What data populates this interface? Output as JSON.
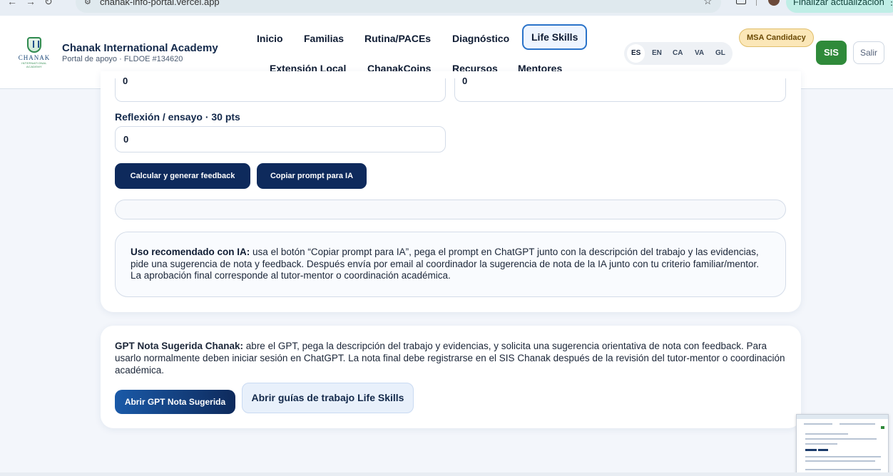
{
  "browser": {
    "url": "chanak-info-portal.vercel.app",
    "update_label": "Finalizar actualización"
  },
  "header": {
    "brand_name": "Chanak International Academy",
    "brand_sub": "Portal de apoyo · FLDOE #134620",
    "logo_text": "CHANAK",
    "logo_tagline": "INTERNATIONAL ACADEMY",
    "nav": {
      "inicio": "Inicio",
      "familias": "Familias",
      "rutina": "Rutina/PACEs",
      "diagnostico": "Diagnóstico",
      "life_skills": "Life Skills",
      "extension": "Extensión Local",
      "coins": "ChanakCoins",
      "recursos": "Recursos",
      "mentores": "Mentores"
    },
    "languages": {
      "es": "ES",
      "en": "EN",
      "ca": "CA",
      "va": "VA",
      "gl": "GL"
    },
    "msa_badge": "MSA Candidacy",
    "sis_button": "SIS",
    "logout_button": "Salir"
  },
  "form": {
    "stub_left_value": "0",
    "stub_right_value": "0",
    "reflection_label": "Reflexión / ensayo · 30 pts",
    "reflection_value": "0",
    "calc_button": "Calcular y generar feedback",
    "copy_prompt_button": "Copiar prompt para IA"
  },
  "info": {
    "title": "Uso recomendado con IA:",
    "body": "usa el botón “Copiar prompt para IA”, pega el prompt en ChatGPT junto con la descripción del trabajo y las evidencias, pide una sugerencia de nota y feedback. Después envía por email al coordinador la sugerencia de nota de la IA junto con tu criterio familiar/mentor. La aprobación final corresponde al tutor-mentor o coordinación académica."
  },
  "gpt_card": {
    "title": "GPT Nota Sugerida Chanak:",
    "body": "abre el GPT, pega la descripción del trabajo y evidencias, y solicita una sugerencia orientativa de nota con feedback. Para usarlo normalmente deben iniciar sesión en ChatGPT. La nota final debe registrarse en el SIS Chanak después de la revisión del tutor-mentor o coordinación académica.",
    "open_gpt_button": "Abrir GPT Nota Sugerida",
    "open_guides_button": "Abrir guías de trabajo Life Skills"
  },
  "colors": {
    "primary_dark": "#0e2a5c",
    "active_nav_border": "#2a73c9",
    "sis_green": "#2f8a3a",
    "msa_badge_bg": "#fbe7b8",
    "page_bg": "#f3f6fb"
  }
}
